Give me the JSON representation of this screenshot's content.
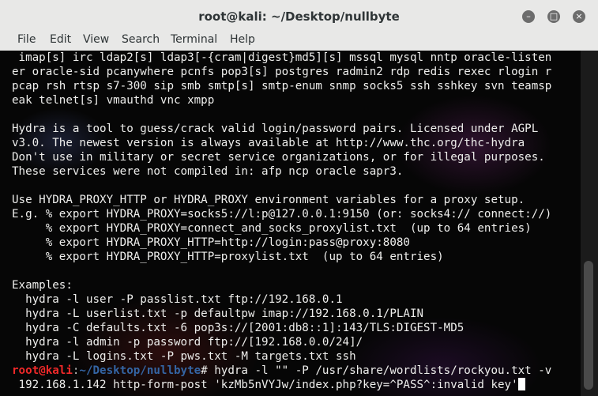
{
  "window": {
    "title": "root@kali: ~/Desktop/nullbyte",
    "minimize_icon": "minimize-icon",
    "maximize_icon": "maximize-icon",
    "close_icon": "close-icon"
  },
  "menu": [
    "File",
    "Edit",
    "View",
    "Search",
    "Terminal",
    "Help"
  ],
  "terminal": {
    "lines": [
      " imap[s] irc ldap2[s] ldap3[-{cram|digest}md5][s] mssql mysql nntp oracle-listen",
      "er oracle-sid pcanywhere pcnfs pop3[s] postgres radmin2 rdp redis rexec rlogin r",
      "pcap rsh rtsp s7-300 sip smb smtp[s] smtp-enum snmp socks5 ssh sshkey svn teamsp",
      "eak telnet[s] vmauthd vnc xmpp",
      "",
      "Hydra is a tool to guess/crack valid login/password pairs. Licensed under AGPL",
      "v3.0. The newest version is always available at http://www.thc.org/thc-hydra",
      "Don't use in military or secret service organizations, or for illegal purposes.",
      "These services were not compiled in: afp ncp oracle sapr3.",
      "",
      "Use HYDRA_PROXY_HTTP or HYDRA_PROXY environment variables for a proxy setup.",
      "E.g. % export HYDRA_PROXY=socks5://l:p@127.0.0.1:9150 (or: socks4:// connect://)",
      "     % export HYDRA_PROXY=connect_and_socks_proxylist.txt  (up to 64 entries)",
      "     % export HYDRA_PROXY_HTTP=http://login:pass@proxy:8080",
      "     % export HYDRA_PROXY_HTTP=proxylist.txt  (up to 64 entries)",
      "",
      "Examples:",
      "  hydra -l user -P passlist.txt ftp://192.168.0.1",
      "  hydra -L userlist.txt -p defaultpw imap://192.168.0.1/PLAIN",
      "  hydra -C defaults.txt -6 pop3s://[2001:db8::1]:143/TLS:DIGEST-MD5",
      "  hydra -l admin -p password ftp://[192.168.0.0/24]/",
      "  hydra -L logins.txt -P pws.txt -M targets.txt ssh"
    ],
    "prompt": {
      "user": "root@kali",
      "sep": ":",
      "path": "~/Desktop/nullbyte",
      "symbol": "# ",
      "command": "hydra -l \"\" -P /usr/share/wordlists/rockyou.txt -v",
      "continuation": " 192.168.1.142 http-form-post 'kzMb5nVYJw/index.php?key=^PASS^:invalid key'"
    }
  },
  "colors": {
    "prompt_user": "#ef2929",
    "prompt_path": "#3465a4",
    "text": "#eeeeec",
    "titlebar": "#e8e8e7"
  }
}
